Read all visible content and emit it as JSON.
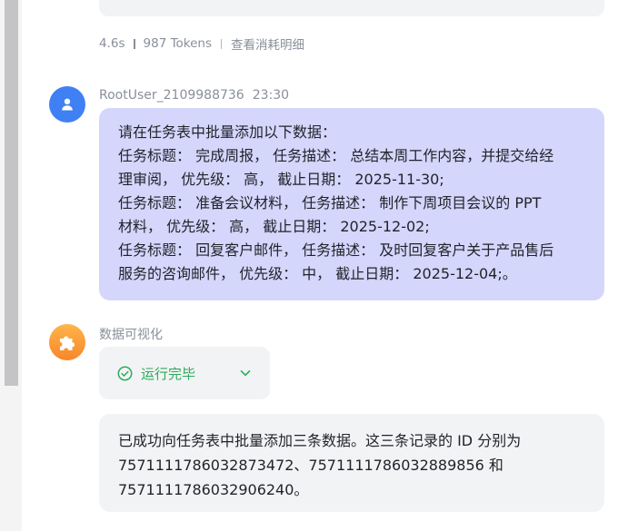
{
  "previous_message": {
    "stats": {
      "duration": "4.6s",
      "tokens": "987 Tokens",
      "details_link": "查看消耗明细"
    }
  },
  "user_message": {
    "author": "RootUser_2109988736",
    "time": "23:30",
    "lines": [
      "请在任务表中批量添加以下数据：",
      "任务标题： 完成周报， 任务描述： 总结本周工作内容，并提交给经",
      "理审阅， 优先级： 高， 截止日期： 2025-11-30;",
      "任务标题： 准备会议材料， 任务描述： 制作下周项目会议的 PPT",
      "材料， 优先级： 高， 截止日期： 2025-12-02;",
      "任务标题： 回复客户邮件， 任务描述： 及时回复客户关于产品售后",
      "服务的咨询邮件， 优先级： 中， 截止日期： 2025-12-04;。"
    ]
  },
  "bot_message": {
    "plugin_name": "数据可视化",
    "status": {
      "label": "运行完毕",
      "icon": "check-circle-icon",
      "color": "#2bab5a"
    },
    "reply_lines": [
      "已成功向任务表中批量添加三条数据。这三条记录的 ID 分别为",
      "7571111786032873472、7571111786032889856 和",
      "7571111786032906240。"
    ]
  },
  "colors": {
    "user_bubble": "#d4d6fb",
    "card": "#f2f3f5",
    "user_avatar": "#3f80f5",
    "plugin_avatar": "#f7862a",
    "meta_text": "#8a8f99"
  }
}
